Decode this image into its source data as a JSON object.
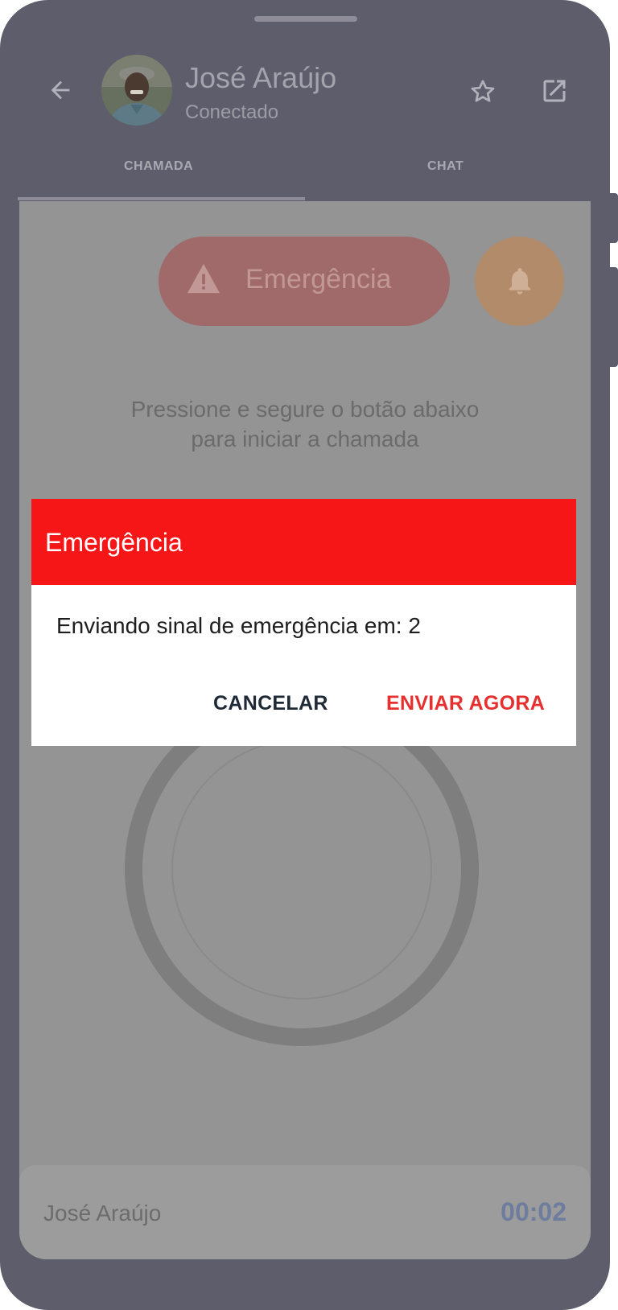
{
  "header": {
    "contact_name": "José Araújo",
    "contact_status": "Conectado"
  },
  "tabs": [
    {
      "label": "CHAMADA",
      "active": true
    },
    {
      "label": "CHAT",
      "active": false
    }
  ],
  "call_panel": {
    "emergency_button_label": "Emergência",
    "instruction_line1": "Pressione e segure o botão abaixo",
    "instruction_line2": "para iniciar a chamada"
  },
  "bottom_bar": {
    "name": "José Araújo",
    "timer": "00:02"
  },
  "dialog": {
    "title": "Emergência",
    "message": "Enviando sinal de emergência em: 2",
    "cancel_label": "CANCELAR",
    "send_label": "ENVIAR AGORA"
  },
  "colors": {
    "dialog_header": "#f71617",
    "send_action": "#e6302f",
    "frame": "#5e5d6b",
    "overlay": "#949494"
  },
  "icons": [
    "back-arrow-icon",
    "star-icon",
    "open-external-icon",
    "warning-icon",
    "bell-icon"
  ]
}
